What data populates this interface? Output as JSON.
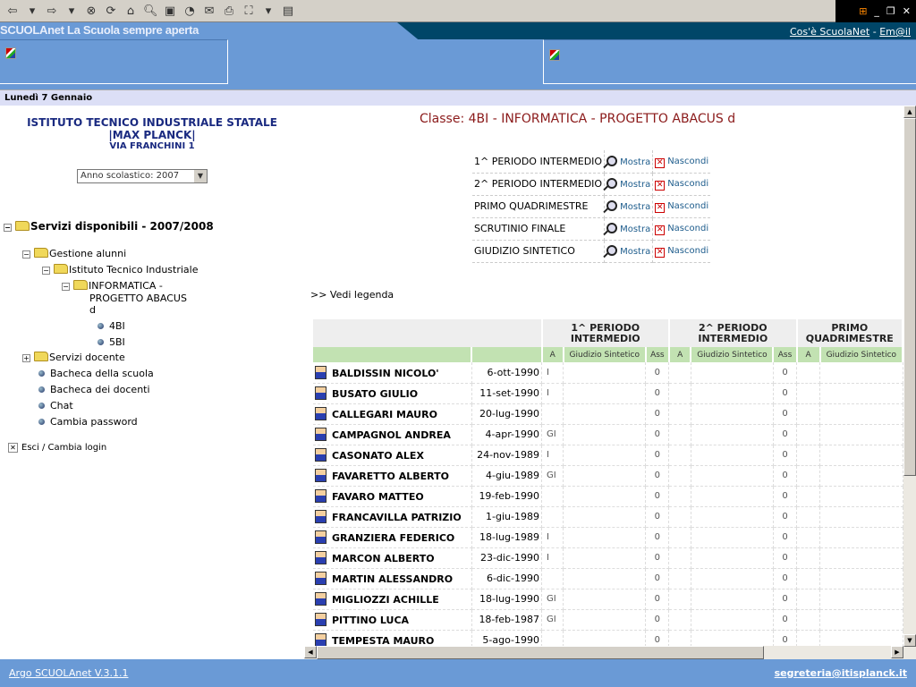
{
  "browser": {
    "toolbar_icons": [
      "back-icon",
      "dropdown-icon",
      "forward-icon",
      "dropdown-icon",
      "stop-icon",
      "refresh-icon",
      "home-icon",
      "search-icon",
      "favorites-icon",
      "history-icon",
      "mail-icon",
      "print-icon",
      "fullscreen-icon",
      "dropdown-icon",
      "edit-icon"
    ]
  },
  "header": {
    "brand": "SCUOLAnet La Scuola sempre aperta",
    "links": [
      "Cos'è ScuolaNet",
      "Em@il"
    ],
    "separator": "-"
  },
  "date": "Lunedì 7 Gennaio",
  "school": {
    "name": "ISTITUTO TECNICO INDUSTRIALE STATALE",
    "name2": "|MAX PLANCK|",
    "address": "VIA FRANCHINI 1"
  },
  "year_select": {
    "value": "Anno scolastico: 2007"
  },
  "tree": {
    "root": "Servizi disponibili - 2007/2008",
    "gestione": "Gestione alunni",
    "istituto": "Istituto Tecnico Industriale",
    "corso1": "INFORMATICA -",
    "corso2": "PROGETTO ABACUS",
    "corso3": "d",
    "classes": [
      "4BI",
      "5BI"
    ],
    "docente": "Servizi docente",
    "links": [
      "Bacheca della scuola",
      "Bacheca dei docenti",
      "Chat",
      "Cambia password"
    ],
    "logout": "Esci / Cambia login"
  },
  "main": {
    "title": "Classe: 4BI - INFORMATICA - PROGETTO ABACUS d",
    "periods": [
      "1^ PERIODO INTERMEDIO",
      "2^ PERIODO INTERMEDIO",
      "PRIMO QUADRIMESTRE",
      "SCRUTINIO FINALE",
      "GIUDIZIO SINTETICO"
    ],
    "show": "Mostra",
    "hide": "Nascondi",
    "legend": ">> Vedi legenda",
    "group_headers": [
      "1^ PERIODO INTERMEDIO",
      "2^ PERIODO INTERMEDIO",
      "PRIMO QUADRIMESTRE"
    ],
    "sub_headers": [
      "A",
      "Giudizio Sintetico",
      "Ass"
    ],
    "students": [
      [
        "BALDISSIN NICOLO'",
        "6-ott-1990",
        "I",
        "0",
        "0"
      ],
      [
        "BUSATO GIULIO",
        "11-set-1990",
        "I",
        "0",
        "0"
      ],
      [
        "CALLEGARI MAURO",
        "20-lug-1990",
        "",
        "0",
        "0"
      ],
      [
        "CAMPAGNOL ANDREA",
        "4-apr-1990",
        "GI",
        "0",
        "0"
      ],
      [
        "CASONATO ALEX",
        "24-nov-1989",
        "I",
        "0",
        "0"
      ],
      [
        "FAVARETTO ALBERTO",
        "4-giu-1989",
        "GI",
        "0",
        "0"
      ],
      [
        "FAVARO MATTEO",
        "19-feb-1990",
        "",
        "0",
        "0"
      ],
      [
        "FRANCAVILLA PATRIZIO",
        "1-giu-1989",
        "",
        "0",
        "0"
      ],
      [
        "GRANZIERA FEDERICO",
        "18-lug-1989",
        "I",
        "0",
        "0"
      ],
      [
        "MARCON ALBERTO",
        "23-dic-1990",
        "I",
        "0",
        "0"
      ],
      [
        "MARTIN ALESSANDRO",
        "6-dic-1990",
        "",
        "0",
        "0"
      ],
      [
        "MIGLIOZZI ACHILLE",
        "18-lug-1990",
        "GI",
        "0",
        "0"
      ],
      [
        "PITTINO LUCA",
        "18-feb-1987",
        "GI",
        "0",
        "0"
      ],
      [
        "TEMPESTA MAURO",
        "5-ago-1990",
        "",
        "0",
        "0"
      ]
    ]
  },
  "footer": {
    "version": "Argo SCUOLAnet V.3.1.1",
    "email": "segreteria@itisplanck.it"
  }
}
